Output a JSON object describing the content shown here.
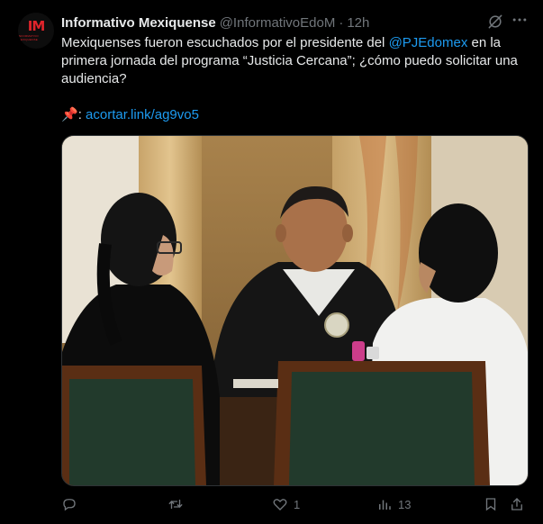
{
  "tweet": {
    "avatar_logo": "IM",
    "avatar_sub": "INFORMATIVO MEXIQUENSE",
    "author_name": "Informativo Mexiquense",
    "author_handle": "@InformativoEdoM",
    "separator": "·",
    "timestamp": "12h",
    "text_part1": "Mexiquenses fueron escuchados por el presidente del ",
    "mention": "@PJEdomex",
    "text_part2": " en la primera jornada del programa “Justicia Cercana”; ¿cómo puedo solicitar una audiencia?",
    "pin_emoji": "📌",
    "link_prefix": ": ",
    "link": "acortar.link/ag9vo5",
    "media_icons": [
      "grok-icon",
      "more-icon"
    ]
  },
  "actions": {
    "reply_count": "",
    "retweet_count": "",
    "like_count": "1",
    "views_count": "13",
    "icons": [
      "reply-icon",
      "retweet-icon",
      "like-icon",
      "views-icon",
      "bookmark-icon",
      "share-icon"
    ]
  },
  "colors": {
    "background": "#000000",
    "text": "#e7e9ea",
    "muted": "#71767b",
    "accent": "#1d9bf0",
    "logo": "#e0242b"
  }
}
